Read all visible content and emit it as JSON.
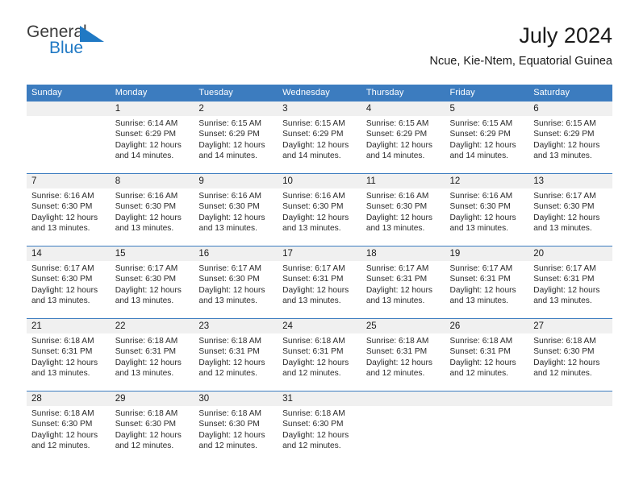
{
  "brand": {
    "name_part1": "General",
    "name_part2": "Blue",
    "flag_icon": "triangle-flag-icon",
    "color_primary": "#2079c4",
    "color_text": "#3b3b3b"
  },
  "header": {
    "title": "July 2024",
    "subtitle": "Ncue, Kie-Ntem, Equatorial Guinea"
  },
  "calendar": {
    "header_bg": "#3c7cbf",
    "header_text_color": "#ffffff",
    "daynum_bg": "#f0f0f0",
    "weekdays": [
      "Sunday",
      "Monday",
      "Tuesday",
      "Wednesday",
      "Thursday",
      "Friday",
      "Saturday"
    ],
    "weeks": [
      [
        {
          "day": "",
          "lines": []
        },
        {
          "day": "1",
          "lines": [
            "Sunrise: 6:14 AM",
            "Sunset: 6:29 PM",
            "Daylight: 12 hours",
            "and 14 minutes."
          ]
        },
        {
          "day": "2",
          "lines": [
            "Sunrise: 6:15 AM",
            "Sunset: 6:29 PM",
            "Daylight: 12 hours",
            "and 14 minutes."
          ]
        },
        {
          "day": "3",
          "lines": [
            "Sunrise: 6:15 AM",
            "Sunset: 6:29 PM",
            "Daylight: 12 hours",
            "and 14 minutes."
          ]
        },
        {
          "day": "4",
          "lines": [
            "Sunrise: 6:15 AM",
            "Sunset: 6:29 PM",
            "Daylight: 12 hours",
            "and 14 minutes."
          ]
        },
        {
          "day": "5",
          "lines": [
            "Sunrise: 6:15 AM",
            "Sunset: 6:29 PM",
            "Daylight: 12 hours",
            "and 14 minutes."
          ]
        },
        {
          "day": "6",
          "lines": [
            "Sunrise: 6:15 AM",
            "Sunset: 6:29 PM",
            "Daylight: 12 hours",
            "and 13 minutes."
          ]
        }
      ],
      [
        {
          "day": "7",
          "lines": [
            "Sunrise: 6:16 AM",
            "Sunset: 6:30 PM",
            "Daylight: 12 hours",
            "and 13 minutes."
          ]
        },
        {
          "day": "8",
          "lines": [
            "Sunrise: 6:16 AM",
            "Sunset: 6:30 PM",
            "Daylight: 12 hours",
            "and 13 minutes."
          ]
        },
        {
          "day": "9",
          "lines": [
            "Sunrise: 6:16 AM",
            "Sunset: 6:30 PM",
            "Daylight: 12 hours",
            "and 13 minutes."
          ]
        },
        {
          "day": "10",
          "lines": [
            "Sunrise: 6:16 AM",
            "Sunset: 6:30 PM",
            "Daylight: 12 hours",
            "and 13 minutes."
          ]
        },
        {
          "day": "11",
          "lines": [
            "Sunrise: 6:16 AM",
            "Sunset: 6:30 PM",
            "Daylight: 12 hours",
            "and 13 minutes."
          ]
        },
        {
          "day": "12",
          "lines": [
            "Sunrise: 6:16 AM",
            "Sunset: 6:30 PM",
            "Daylight: 12 hours",
            "and 13 minutes."
          ]
        },
        {
          "day": "13",
          "lines": [
            "Sunrise: 6:17 AM",
            "Sunset: 6:30 PM",
            "Daylight: 12 hours",
            "and 13 minutes."
          ]
        }
      ],
      [
        {
          "day": "14",
          "lines": [
            "Sunrise: 6:17 AM",
            "Sunset: 6:30 PM",
            "Daylight: 12 hours",
            "and 13 minutes."
          ]
        },
        {
          "day": "15",
          "lines": [
            "Sunrise: 6:17 AM",
            "Sunset: 6:30 PM",
            "Daylight: 12 hours",
            "and 13 minutes."
          ]
        },
        {
          "day": "16",
          "lines": [
            "Sunrise: 6:17 AM",
            "Sunset: 6:30 PM",
            "Daylight: 12 hours",
            "and 13 minutes."
          ]
        },
        {
          "day": "17",
          "lines": [
            "Sunrise: 6:17 AM",
            "Sunset: 6:31 PM",
            "Daylight: 12 hours",
            "and 13 minutes."
          ]
        },
        {
          "day": "18",
          "lines": [
            "Sunrise: 6:17 AM",
            "Sunset: 6:31 PM",
            "Daylight: 12 hours",
            "and 13 minutes."
          ]
        },
        {
          "day": "19",
          "lines": [
            "Sunrise: 6:17 AM",
            "Sunset: 6:31 PM",
            "Daylight: 12 hours",
            "and 13 minutes."
          ]
        },
        {
          "day": "20",
          "lines": [
            "Sunrise: 6:17 AM",
            "Sunset: 6:31 PM",
            "Daylight: 12 hours",
            "and 13 minutes."
          ]
        }
      ],
      [
        {
          "day": "21",
          "lines": [
            "Sunrise: 6:18 AM",
            "Sunset: 6:31 PM",
            "Daylight: 12 hours",
            "and 13 minutes."
          ]
        },
        {
          "day": "22",
          "lines": [
            "Sunrise: 6:18 AM",
            "Sunset: 6:31 PM",
            "Daylight: 12 hours",
            "and 13 minutes."
          ]
        },
        {
          "day": "23",
          "lines": [
            "Sunrise: 6:18 AM",
            "Sunset: 6:31 PM",
            "Daylight: 12 hours",
            "and 12 minutes."
          ]
        },
        {
          "day": "24",
          "lines": [
            "Sunrise: 6:18 AM",
            "Sunset: 6:31 PM",
            "Daylight: 12 hours",
            "and 12 minutes."
          ]
        },
        {
          "day": "25",
          "lines": [
            "Sunrise: 6:18 AM",
            "Sunset: 6:31 PM",
            "Daylight: 12 hours",
            "and 12 minutes."
          ]
        },
        {
          "day": "26",
          "lines": [
            "Sunrise: 6:18 AM",
            "Sunset: 6:31 PM",
            "Daylight: 12 hours",
            "and 12 minutes."
          ]
        },
        {
          "day": "27",
          "lines": [
            "Sunrise: 6:18 AM",
            "Sunset: 6:30 PM",
            "Daylight: 12 hours",
            "and 12 minutes."
          ]
        }
      ],
      [
        {
          "day": "28",
          "lines": [
            "Sunrise: 6:18 AM",
            "Sunset: 6:30 PM",
            "Daylight: 12 hours",
            "and 12 minutes."
          ]
        },
        {
          "day": "29",
          "lines": [
            "Sunrise: 6:18 AM",
            "Sunset: 6:30 PM",
            "Daylight: 12 hours",
            "and 12 minutes."
          ]
        },
        {
          "day": "30",
          "lines": [
            "Sunrise: 6:18 AM",
            "Sunset: 6:30 PM",
            "Daylight: 12 hours",
            "and 12 minutes."
          ]
        },
        {
          "day": "31",
          "lines": [
            "Sunrise: 6:18 AM",
            "Sunset: 6:30 PM",
            "Daylight: 12 hours",
            "and 12 minutes."
          ]
        },
        {
          "day": "",
          "lines": []
        },
        {
          "day": "",
          "lines": []
        },
        {
          "day": "",
          "lines": []
        }
      ]
    ]
  }
}
